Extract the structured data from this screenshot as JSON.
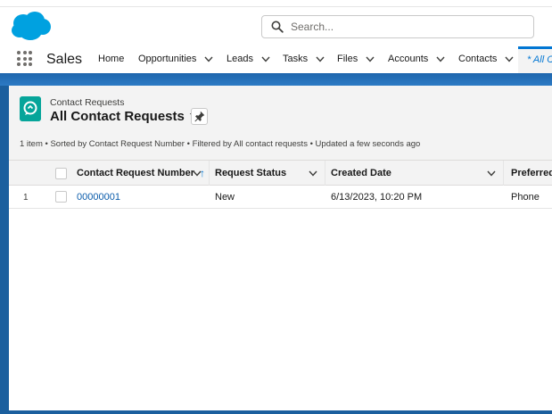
{
  "header": {
    "search_placeholder": "Search..."
  },
  "nav": {
    "app_name": "Sales",
    "items": [
      {
        "label": "Home",
        "has_menu": false
      },
      {
        "label": "Opportunities",
        "has_menu": true
      },
      {
        "label": "Leads",
        "has_menu": true
      },
      {
        "label": "Tasks",
        "has_menu": true
      },
      {
        "label": "Files",
        "has_menu": true
      },
      {
        "label": "Accounts",
        "has_menu": true
      },
      {
        "label": "Contacts",
        "has_menu": true
      }
    ],
    "active_tab_label": "* All Co"
  },
  "list_view": {
    "object_label": "Contact Requests",
    "title": "All Contact Requests",
    "summary": "1 item • Sorted by Contact Request Number • Filtered by All contact requests • Updated a few seconds ago"
  },
  "table": {
    "columns": [
      {
        "label": "Contact Request Number",
        "sort_indicator": "↑"
      },
      {
        "label": "Request Status"
      },
      {
        "label": "Created Date"
      },
      {
        "label": "Preferred"
      }
    ],
    "rows": [
      {
        "row_number": "1",
        "number": "00000001",
        "status": "New",
        "created": "6/13/2023, 10:20 PM",
        "preferred": "Phone"
      }
    ]
  },
  "colors": {
    "brand_blue": "#0176d3",
    "link": "#0b5cab",
    "object_icon": "#06a59a",
    "background_band": "#1b5f9e"
  },
  "icons": [
    "salesforce-cloud-logo",
    "search-icon",
    "app-launcher-icon",
    "chevron-down-icon",
    "contact-request-icon",
    "caret-down-icon",
    "pin-icon",
    "sort-ascending-icon"
  ]
}
